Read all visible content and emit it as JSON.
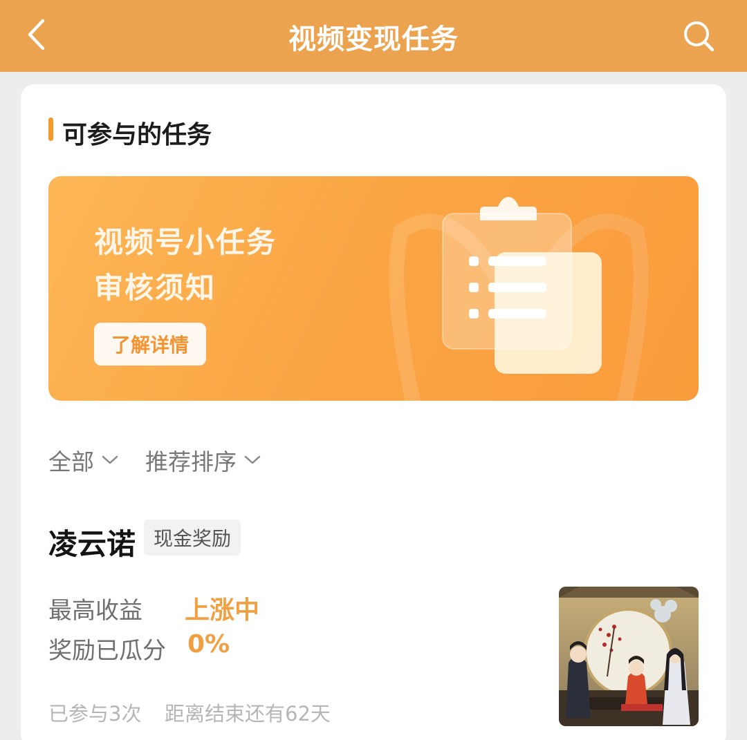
{
  "header": {
    "title": "视频变现任务",
    "back_icon": "chevron-left-icon",
    "search_icon": "search-icon"
  },
  "section": {
    "title": "可参与的任务"
  },
  "banner": {
    "line1": "视频号小任务",
    "line2": "审核须知",
    "button": "了解详情",
    "icon": "clipboard-icon"
  },
  "filters": [
    {
      "label": "全部"
    },
    {
      "label": "推荐排序"
    }
  ],
  "task": {
    "name": "凌云诺",
    "tag": "现金奖励",
    "rows": [
      {
        "label": "最高收益",
        "value": "上涨中"
      },
      {
        "label": "奖励已瓜分",
        "value": "0%"
      }
    ],
    "participated": "已参与3次",
    "remaining": "距离结束还有62天"
  },
  "colors": {
    "header_bg": "#eca34f",
    "accent": "#f39a2f",
    "value": "#f0a041"
  }
}
